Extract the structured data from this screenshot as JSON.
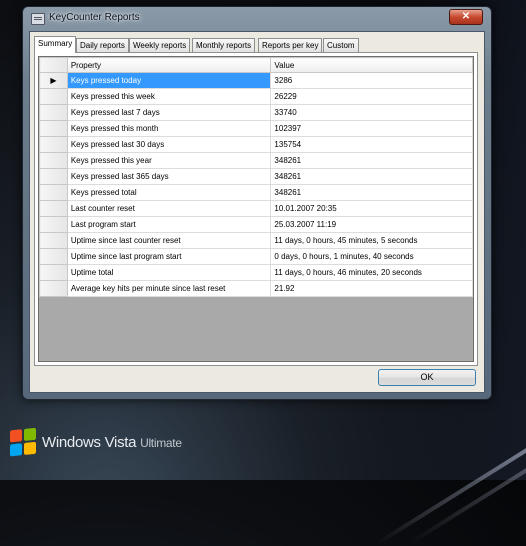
{
  "window": {
    "title": "KeyCounter Reports",
    "close_glyph": "✕"
  },
  "tabs": [
    "Summary",
    "Daily reports",
    "Weekly reports",
    "Monthly reports",
    "Reports per key",
    "Custom"
  ],
  "grid": {
    "columns": [
      "Property",
      "Value"
    ],
    "current_row_marker": "▶",
    "rows": [
      {
        "property": "Keys pressed today",
        "value": "3286"
      },
      {
        "property": "Keys pressed this week",
        "value": "26229"
      },
      {
        "property": "Keys pressed last 7 days",
        "value": "33740"
      },
      {
        "property": "Keys pressed this month",
        "value": "102397"
      },
      {
        "property": "Keys pressed last 30 days",
        "value": "135754"
      },
      {
        "property": "Keys pressed this year",
        "value": "348261"
      },
      {
        "property": "Keys pressed last 365 days",
        "value": "348261"
      },
      {
        "property": "Keys pressed total",
        "value": "348261"
      },
      {
        "property": "Last counter reset",
        "value": "10.01.2007 20:35"
      },
      {
        "property": "Last program start",
        "value": "25.03.2007 11:19"
      },
      {
        "property": "Uptime since last counter reset",
        "value": "11 days, 0 hours, 45 minutes, 5 seconds"
      },
      {
        "property": "Uptime since last program start",
        "value": "0 days, 0 hours, 1 minutes, 40 seconds"
      },
      {
        "property": "Uptime total",
        "value": "11 days, 0 hours, 46 minutes, 20 seconds"
      },
      {
        "property": "Average key hits per minute since last reset",
        "value": "21.92"
      }
    ]
  },
  "buttons": {
    "ok": "OK"
  },
  "branding": {
    "name": "Windows Vista",
    "edition": "Ultimate"
  },
  "colors": {
    "selection": "#3399ff",
    "flag": [
      "#f25022",
      "#7fba00",
      "#00a4ef",
      "#ffb900"
    ]
  }
}
